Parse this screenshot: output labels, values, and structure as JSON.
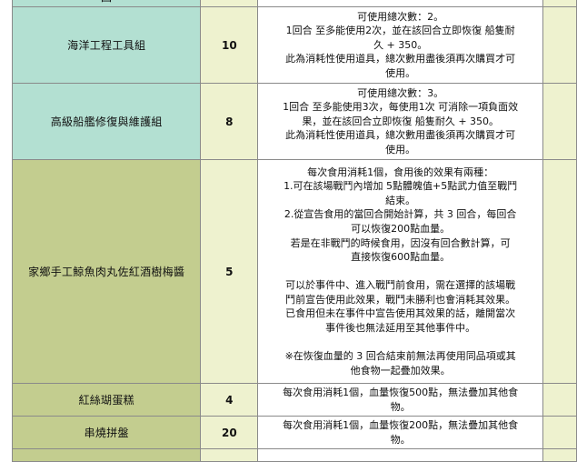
{
  "rows": [
    {
      "name": "回",
      "qty": "",
      "desc": []
    },
    {
      "name": "海洋工程工具組",
      "qty": "10",
      "desc": [
        "可使用總次數：2。",
        "1回合 至多能使用2次，並在該回合立即恢復 船隻耐",
        "久 + 350。",
        "此為消耗性使用道具，總次數用盡後須再次購買才可",
        "使用。"
      ]
    },
    {
      "name": "高級船艦修復與維護組",
      "qty": "8",
      "desc": [
        "可使用總次數：3。",
        "1回合 至多能使用3次，每使用1次 可消除一項負面效",
        "果，並在該回合立即恢復 船隻耐久 + 350。",
        "此為消耗性使用道具，總次數用盡後須再次購買才可",
        "使用。"
      ]
    },
    {
      "name": "家鄉手工鯨魚肉丸佐紅酒樹梅醬",
      "qty": "5",
      "desc": [
        "每次食用消耗1個，食用後的效果有兩種：",
        "1.可在該場戰鬥內增加 5點體魄值+5點武力值至戰鬥",
        "結束。",
        "2.從宣告食用的當回合開始計算，共 3 回合，每回合",
        "可以恢復200點血量。",
        "若是在非戰鬥的時候食用，因沒有回合數計算，可",
        "直接恢復600點血量。",
        "",
        "可以於事件中、進入戰鬥前食用，需在選擇的該場戰",
        "鬥前宣告使用此效果，戰鬥未勝利也會消耗其效果。",
        "已食用但未在事件中宣告使用其效果的話，離開當次",
        "事件後也無法延用至其他事件中。",
        "",
        "※在恢復血量的 3 回合結束前無法再使用同品項或其",
        "他食物一起疊加效果。"
      ]
    },
    {
      "name": "紅絲瑚蛋糕",
      "qty": "4",
      "desc": [
        "每次食用消耗1個，血量恢復500點，無法疊加其他食",
        "物。"
      ]
    },
    {
      "name": "串燒拼盤",
      "qty": "20",
      "desc": [
        "每次食用消耗1個，血量恢復200點，無法疊加其他食",
        "物。"
      ]
    }
  ]
}
